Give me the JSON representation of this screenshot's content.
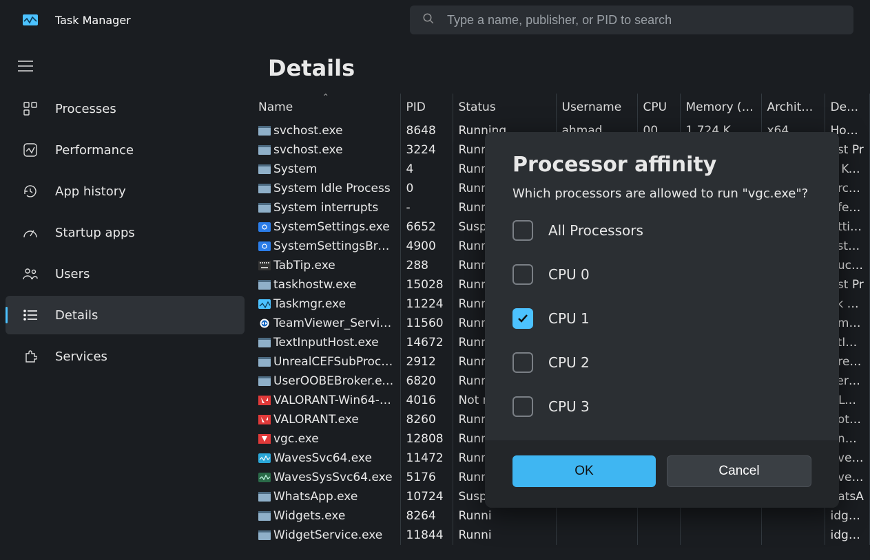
{
  "app": {
    "title": "Task Manager"
  },
  "search": {
    "placeholder": "Type a name, publisher, or PID to search"
  },
  "page": {
    "title": "Details"
  },
  "sidebar": {
    "items": [
      {
        "label": "Processes"
      },
      {
        "label": "Performance"
      },
      {
        "label": "App history"
      },
      {
        "label": "Startup apps"
      },
      {
        "label": "Users"
      },
      {
        "label": "Details"
      },
      {
        "label": "Services"
      }
    ]
  },
  "columns": {
    "name": "Name",
    "pid": "PID",
    "status": "Status",
    "username": "Username",
    "cpu": "CPU",
    "memory": "Memory (ac...",
    "arch": "Architec...",
    "desc": "Descript"
  },
  "rows": [
    {
      "icon": "app",
      "name": "svchost.exe",
      "pid": "8648",
      "status": "Running",
      "user": "ahmad",
      "cpu": "00",
      "mem": "1,724 K",
      "arch": "x64",
      "desc": "Host Pr"
    },
    {
      "icon": "app",
      "name": "svchost.exe",
      "pid": "3224",
      "status": "Runni",
      "desc": "ost Pr"
    },
    {
      "icon": "app",
      "name": "System",
      "pid": "4",
      "status": "Runni",
      "desc": "T Kern"
    },
    {
      "icon": "app",
      "name": "System Idle Process",
      "pid": "0",
      "status": "Runni",
      "desc": "ercenta"
    },
    {
      "icon": "app",
      "name": "System interrupts",
      "pid": "-",
      "status": "Runni",
      "desc": "eferrec"
    },
    {
      "icon": "gear",
      "name": "SystemSettings.exe",
      "pid": "6652",
      "status": "Suspe",
      "desc": "ettings"
    },
    {
      "icon": "gear",
      "name": "SystemSettingsBroke...",
      "pid": "4900",
      "status": "Runni",
      "desc": "ystem"
    },
    {
      "icon": "kbd",
      "name": "TabTip.exe",
      "pid": "288",
      "status": "Runni",
      "desc": "ouch Ke"
    },
    {
      "icon": "app",
      "name": "taskhostw.exe",
      "pid": "15028",
      "status": "Runni",
      "desc": "ost Pr"
    },
    {
      "icon": "tm",
      "name": "Taskmgr.exe",
      "pid": "11224",
      "status": "Runni",
      "desc": "sk Ma"
    },
    {
      "icon": "tv",
      "name": "TeamViewer_Service.e...",
      "pid": "11560",
      "status": "Runni",
      "desc": "amVie"
    },
    {
      "icon": "app",
      "name": "TextInputHost.exe",
      "pid": "14672",
      "status": "Runni",
      "desc": "xtInpu"
    },
    {
      "icon": "app",
      "name": "UnrealCEFSubProcess...",
      "pid": "2912",
      "status": "Runni",
      "desc": "nrealC"
    },
    {
      "icon": "app",
      "name": "UserOOBEBroker.exe",
      "pid": "6820",
      "status": "Runni",
      "desc": "ser OC"
    },
    {
      "icon": "val",
      "name": "VALORANT-Win64-S...",
      "pid": "4016",
      "status": "Not re",
      "desc": "ALORA"
    },
    {
      "icon": "val",
      "name": "VALORANT.exe",
      "pid": "8260",
      "status": "Runni",
      "desc": "ootstra"
    },
    {
      "icon": "vgc",
      "name": "vgc.exe",
      "pid": "12808",
      "status": "Runni",
      "desc": "anguar"
    },
    {
      "icon": "wav",
      "name": "WavesSvc64.exe",
      "pid": "11472",
      "status": "Runni",
      "desc": "aves N"
    },
    {
      "icon": "wav2",
      "name": "WavesSysSvc64.exe",
      "pid": "5176",
      "status": "Runni",
      "desc": "avesSy"
    },
    {
      "icon": "app",
      "name": "WhatsApp.exe",
      "pid": "10724",
      "status": "Suspe",
      "desc": "hatsA"
    },
    {
      "icon": "app",
      "name": "Widgets.exe",
      "pid": "8264",
      "status": "Runni",
      "desc": "idgets"
    },
    {
      "icon": "app",
      "name": "WidgetService.exe",
      "pid": "11844",
      "status": "Runni",
      "desc": "idgetS"
    }
  ],
  "dialog": {
    "title": "Processor affinity",
    "subtitle": "Which processors are allowed to run \"vgc.exe\"?",
    "options": [
      {
        "label": "All Processors",
        "checked": false
      },
      {
        "label": "CPU 0",
        "checked": false
      },
      {
        "label": "CPU 1",
        "checked": true
      },
      {
        "label": "CPU 2",
        "checked": false
      },
      {
        "label": "CPU 3",
        "checked": false
      }
    ],
    "ok": "OK",
    "cancel": "Cancel"
  }
}
